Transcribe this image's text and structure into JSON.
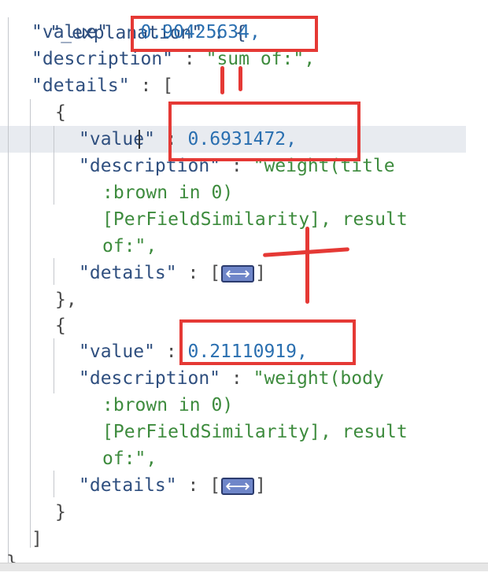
{
  "colors": {
    "key": "#2f4f7f",
    "string": "#3d8b3d",
    "number": "#2a6fb0",
    "annotation": "#e53935",
    "highlight_line": "#e8ebf0"
  },
  "icons": {
    "collapsed_details": "fold-expand-icon"
  },
  "editor": {
    "line_explanation": "\"_explanation\" : {",
    "l1_key": "\"value\"",
    "l1_value": "0.90425634,",
    "l2_key": "\"description\"",
    "l2_value": "\"sum of:\",",
    "l3_key": "\"details\"",
    "l3_bracket": "[",
    "l4_open": "{",
    "l5_key": "\"value\"",
    "l5_value": "0.6931472,",
    "l6_key": "\"description\"",
    "l6_value": "\"weight(title",
    "l7_text": ":brown in 0)",
    "l8_text": "[PerFieldSimilarity], result",
    "l9_text": "of:\",",
    "l10_key": "\"details\"",
    "l10_open": "[",
    "l10_close": "]",
    "l11_close": "},",
    "l12_open": "{",
    "l13_key": "\"value\"",
    "l13_value": "0.21110919,",
    "l14_key": "\"description\"",
    "l14_value": "\"weight(body",
    "l15_text": ":brown in 0)",
    "l16_text": "[PerFieldSimilarity], result",
    "l17_text": "of:\",",
    "l18_key": "\"details\"",
    "l18_open": "[",
    "l18_close": "]",
    "l19_close": "}",
    "l20_close": "]",
    "l21_close": "}",
    "separator": ":"
  }
}
